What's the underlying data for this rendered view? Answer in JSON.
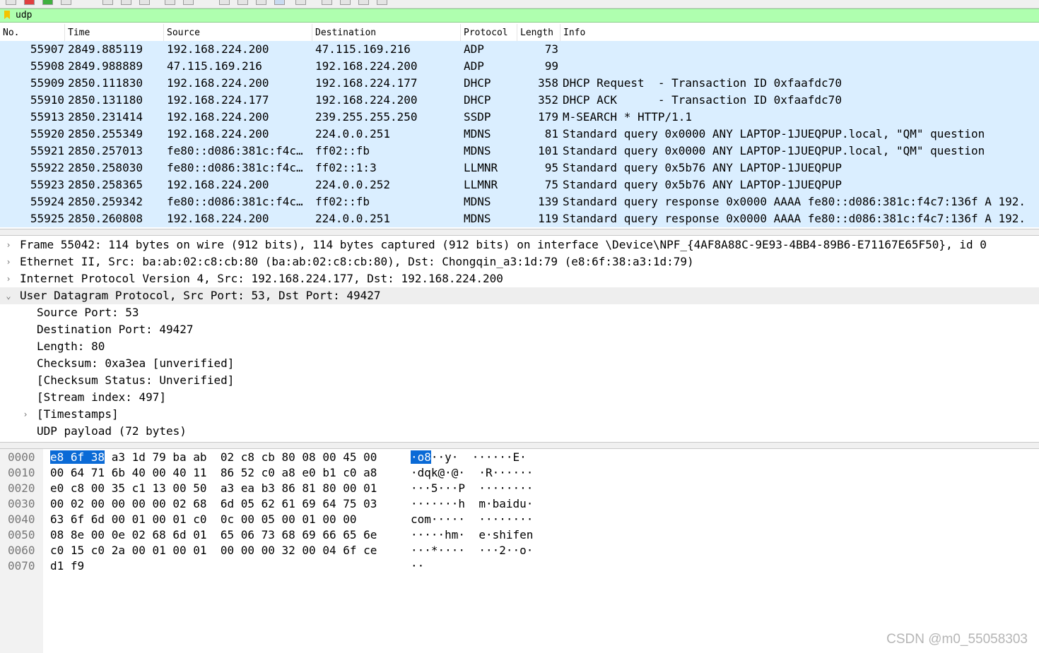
{
  "filter": {
    "value": "udp"
  },
  "columns": [
    "No.",
    "Time",
    "Source",
    "Destination",
    "Protocol",
    "Length",
    "Info"
  ],
  "packets": [
    {
      "no": "55907",
      "time": "2849.885119",
      "src": "192.168.224.200",
      "dst": "47.115.169.216",
      "proto": "ADP",
      "len": "73",
      "info": ""
    },
    {
      "no": "55908",
      "time": "2849.988889",
      "src": "47.115.169.216",
      "dst": "192.168.224.200",
      "proto": "ADP",
      "len": "99",
      "info": ""
    },
    {
      "no": "55909",
      "time": "2850.111830",
      "src": "192.168.224.200",
      "dst": "192.168.224.177",
      "proto": "DHCP",
      "len": "358",
      "info": "DHCP Request  - Transaction ID 0xfaafdc70"
    },
    {
      "no": "55910",
      "time": "2850.131180",
      "src": "192.168.224.177",
      "dst": "192.168.224.200",
      "proto": "DHCP",
      "len": "352",
      "info": "DHCP ACK      - Transaction ID 0xfaafdc70"
    },
    {
      "no": "55913",
      "time": "2850.231414",
      "src": "192.168.224.200",
      "dst": "239.255.255.250",
      "proto": "SSDP",
      "len": "179",
      "info": "M-SEARCH * HTTP/1.1"
    },
    {
      "no": "55920",
      "time": "2850.255349",
      "src": "192.168.224.200",
      "dst": "224.0.0.251",
      "proto": "MDNS",
      "len": "81",
      "info": "Standard query 0x0000 ANY LAPTOP-1JUEQPUP.local, \"QM\" question"
    },
    {
      "no": "55921",
      "time": "2850.257013",
      "src": "fe80::d086:381c:f4c…",
      "dst": "ff02::fb",
      "proto": "MDNS",
      "len": "101",
      "info": "Standard query 0x0000 ANY LAPTOP-1JUEQPUP.local, \"QM\" question"
    },
    {
      "no": "55922",
      "time": "2850.258030",
      "src": "fe80::d086:381c:f4c…",
      "dst": "ff02::1:3",
      "proto": "LLMNR",
      "len": "95",
      "info": "Standard query 0x5b76 ANY LAPTOP-1JUEQPUP"
    },
    {
      "no": "55923",
      "time": "2850.258365",
      "src": "192.168.224.200",
      "dst": "224.0.0.252",
      "proto": "LLMNR",
      "len": "75",
      "info": "Standard query 0x5b76 ANY LAPTOP-1JUEQPUP"
    },
    {
      "no": "55924",
      "time": "2850.259342",
      "src": "fe80::d086:381c:f4c…",
      "dst": "ff02::fb",
      "proto": "MDNS",
      "len": "139",
      "info": "Standard query response 0x0000 AAAA fe80::d086:381c:f4c7:136f A 192."
    },
    {
      "no": "55925",
      "time": "2850.260808",
      "src": "192.168.224.200",
      "dst": "224.0.0.251",
      "proto": "MDNS",
      "len": "119",
      "info": "Standard query response 0x0000 AAAA fe80::d086:381c:f4c7:136f A 192."
    }
  ],
  "details": [
    {
      "text": "Frame 55042: 114 bytes on wire (912 bits), 114 bytes captured (912 bits) on interface \\Device\\NPF_{4AF8A88C-9E93-4BB4-89B6-E71167E65F50}, id 0",
      "indent": 0,
      "expander": "›",
      "selected": false
    },
    {
      "text": "Ethernet II, Src: ba:ab:02:c8:cb:80 (ba:ab:02:c8:cb:80), Dst: Chongqin_a3:1d:79 (e8:6f:38:a3:1d:79)",
      "indent": 0,
      "expander": "›",
      "selected": false
    },
    {
      "text": "Internet Protocol Version 4, Src: 192.168.224.177, Dst: 192.168.224.200",
      "indent": 0,
      "expander": "›",
      "selected": false
    },
    {
      "text": "User Datagram Protocol, Src Port: 53, Dst Port: 49427",
      "indent": 0,
      "expander": "⌄",
      "selected": true
    },
    {
      "text": "Source Port: 53",
      "indent": 1,
      "expander": "",
      "selected": false
    },
    {
      "text": "Destination Port: 49427",
      "indent": 1,
      "expander": "",
      "selected": false
    },
    {
      "text": "Length: 80",
      "indent": 1,
      "expander": "",
      "selected": false
    },
    {
      "text": "Checksum: 0xa3ea [unverified]",
      "indent": 1,
      "expander": "",
      "selected": false
    },
    {
      "text": "[Checksum Status: Unverified]",
      "indent": 1,
      "expander": "",
      "selected": false
    },
    {
      "text": "[Stream index: 497]",
      "indent": 1,
      "expander": "",
      "selected": false
    },
    {
      "text": "[Timestamps]",
      "indent": 1,
      "expander": "›",
      "selected": false
    },
    {
      "text": "UDP payload (72 bytes)",
      "indent": 1,
      "expander": "",
      "selected": false
    }
  ],
  "hex": [
    {
      "off": "0000",
      "hl": "e8 6f 38",
      "bytes": " a3 1d 79 ba ab  02 c8 cb 80 08 00 45 00",
      "ahl": "·o8",
      "ascii": "··y·  ······E·"
    },
    {
      "off": "0010",
      "hl": "",
      "bytes": "00 64 71 6b 40 00 40 11  86 52 c0 a8 e0 b1 c0 a8",
      "ahl": "",
      "ascii": "·dqk@·@·  ·R······"
    },
    {
      "off": "0020",
      "hl": "",
      "bytes": "e0 c8 00 35 c1 13 00 50  a3 ea b3 86 81 80 00 01",
      "ahl": "",
      "ascii": "···5···P  ········"
    },
    {
      "off": "0030",
      "hl": "",
      "bytes": "00 02 00 00 00 00 02 68  6d 05 62 61 69 64 75 03",
      "ahl": "",
      "ascii": "·······h  m·baidu·"
    },
    {
      "off": "0040",
      "hl": "",
      "bytes": "63 6f 6d 00 01 00 01 c0  0c 00 05 00 01 00 00",
      "ahl": "",
      "ascii": "com·····  ········"
    },
    {
      "off": "0050",
      "hl": "",
      "bytes": "08 8e 00 0e 02 68 6d 01  65 06 73 68 69 66 65 6e",
      "ahl": "",
      "ascii": "·····hm·  e·shifen"
    },
    {
      "off": "0060",
      "hl": "",
      "bytes": "c0 15 c0 2a 00 01 00 01  00 00 00 32 00 04 6f ce",
      "ahl": "",
      "ascii": "···*····  ···2··o·"
    },
    {
      "off": "0070",
      "hl": "",
      "bytes": "d1 f9",
      "ahl": "",
      "ascii": "··"
    }
  ],
  "watermark": "CSDN @m0_55058303"
}
